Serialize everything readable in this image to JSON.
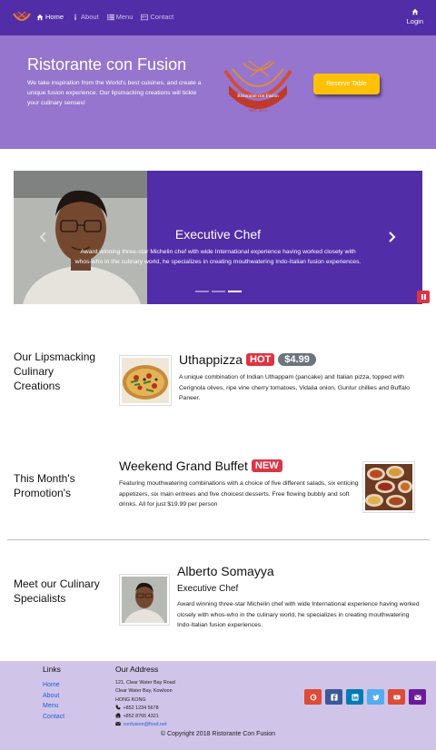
{
  "nav": {
    "items": [
      {
        "label": "Home",
        "icon": "home-icon"
      },
      {
        "label": "About",
        "icon": "info-icon"
      },
      {
        "label": "Menu",
        "icon": "list-icon"
      },
      {
        "label": "Contact",
        "icon": "address-card-icon"
      }
    ],
    "login": "Login"
  },
  "jumbotron": {
    "title": "Ristorante con Fusion",
    "text": "We take inspiration from the World's best cuisines, and create a unique fusion experience. Our lipsmacking creations will tickle your culinary senses!",
    "logo_text": "Ristorante con Fusion",
    "logo_est": "EST. 2013",
    "reserve_label": "Reserve Table"
  },
  "carousel": {
    "title": "Executive Chef",
    "text": "Award winning three-star Michelin chef with wide International experience having worked closely with whos-who in the culinary world, he specializes in creating mouthwatering Indo-Italian fusion experiences.",
    "slide_count": 3,
    "active_slide": 3
  },
  "dish": {
    "heading": "Our Lipsmacking Culinary Creations",
    "name": "Uthappizza",
    "badge": "HOT",
    "price": "$4.99",
    "description": "A unique combination of Indian Uthappam (pancake) and Italian pizza, topped with Cerignola olives, ripe vine cherry tomatoes, Vidalia onion, Guntur chillies and Buffalo Paneer."
  },
  "promotion": {
    "heading": "This Month's Promotion's",
    "name": "Weekend Grand Buffet",
    "badge": "NEW",
    "description": "Featuring mouthwatering combinations with a choice of five different salads, six enticing appetizers, six main entrees and five choicest desserts. Free flowing bubbly and soft drinks. All for just $19.99 per person"
  },
  "leader": {
    "heading": "Meet our Culinary Specialists",
    "name": "Alberto Somayya",
    "designation": "Executive Chef",
    "description": "Award winning three-star Michelin chef with wide International experience having worked closely with whos-who in the culinary world, he specializes in creating mouthwatering Indo-Italian fusion experiences."
  },
  "footer": {
    "links_heading": "Links",
    "links": [
      "Home",
      "About",
      "Menu",
      "Contact"
    ],
    "address_heading": "Our Address",
    "address_lines": [
      "121, Clear Water Bay Road",
      "Clear Water Bay, Kowloon",
      "HONG KONG"
    ],
    "phone": "+852 1234 5678",
    "fax": "+852 8765 4321",
    "email": "confusion@food.net",
    "social": [
      {
        "name": "google-plus-icon",
        "color": "#dd4b39"
      },
      {
        "name": "facebook-icon",
        "color": "#3b5998"
      },
      {
        "name": "linkedin-icon",
        "color": "#007bb6"
      },
      {
        "name": "twitter-icon",
        "color": "#55acee"
      },
      {
        "name": "youtube-icon",
        "color": "#bb0000"
      },
      {
        "name": "mail-icon",
        "color": "#6a1b9a"
      }
    ],
    "copyright": "© Copyright 2018 Ristorante Con Fusion"
  },
  "colors": {
    "primary_dark": "#512da8",
    "primary": "#9575cd",
    "primary_light": "#d1c4e9",
    "warning": "#ffc107",
    "danger": "#dc3545"
  }
}
